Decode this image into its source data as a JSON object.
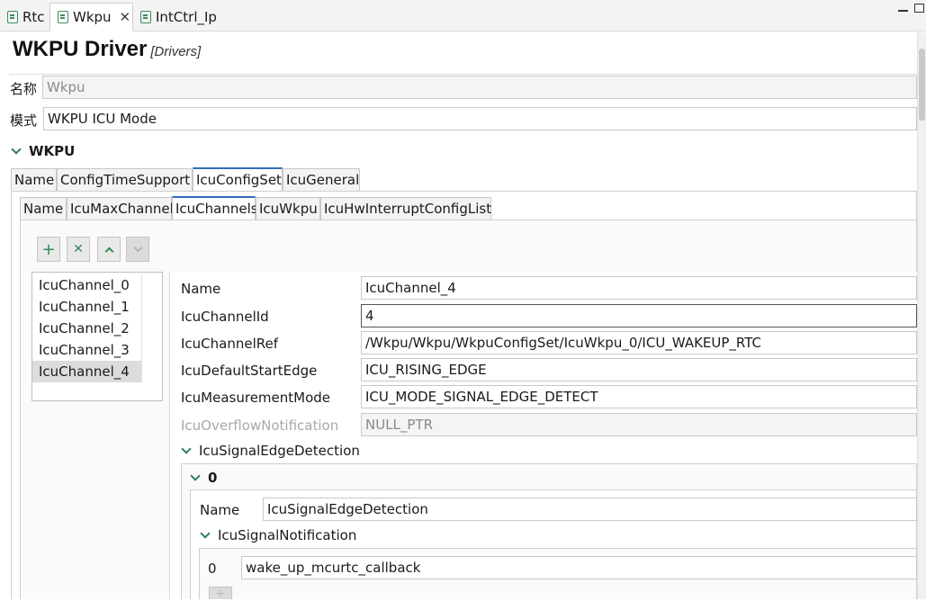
{
  "tabs": [
    {
      "label": "Rtc"
    },
    {
      "label": "Wkpu"
    },
    {
      "label": "IntCtrl_Ip"
    }
  ],
  "header": {
    "title": "WKPU Driver",
    "subtitle": "[Drivers]"
  },
  "fields": {
    "name_label": "名称",
    "name_value": "Wkpu",
    "mode_label": "模式",
    "mode_value": "WKPU ICU Mode"
  },
  "section": {
    "title": "WKPU"
  },
  "outer_tabs": [
    "Name",
    "ConfigTimeSupport",
    "IcuConfigSet",
    "IcuGeneral"
  ],
  "inner_tabs": [
    "Name",
    "IcuMaxChannel",
    "IcuChannels",
    "IcuWkpu",
    "IcuHwInterruptConfigList"
  ],
  "toolbar": {
    "add": "+",
    "remove": "✕",
    "up": "^",
    "down": "v"
  },
  "channels": [
    "IcuChannel_0",
    "IcuChannel_1",
    "IcuChannel_2",
    "IcuChannel_3",
    "IcuChannel_4"
  ],
  "detail": {
    "rows": [
      {
        "label": "Name",
        "value": "IcuChannel_4"
      },
      {
        "label": "IcuChannelId",
        "value": "4"
      },
      {
        "label": "IcuChannelRef",
        "value": "/Wkpu/Wkpu/WkpuConfigSet/IcuWkpu_0/ICU_WAKEUP_RTC"
      },
      {
        "label": "IcuDefaultStartEdge",
        "value": "ICU_RISING_EDGE"
      },
      {
        "label": "IcuMeasurementMode",
        "value": "ICU_MODE_SIGNAL_EDGE_DETECT"
      },
      {
        "label": "IcuOverflowNotification",
        "value": "NULL_PTR"
      }
    ],
    "edge_section": "IcuSignalEdgeDetection",
    "edge_index": "0",
    "edge_name_label": "Name",
    "edge_name_value": "IcuSignalEdgeDetection",
    "notif_section": "IcuSignalNotification",
    "notif_index": "0",
    "notif_value": "wake_up_mcurtc_callback"
  }
}
